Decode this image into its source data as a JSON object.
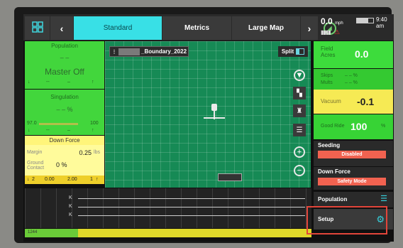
{
  "topbar": {
    "tabs": [
      "Standard",
      "Metrics",
      "Large Map"
    ],
    "active_tab": "Standard",
    "speed_value": "0.0",
    "speed_unit": "mph",
    "clock": "9:40 am",
    "colors": {
      "active_tab": "#38e0e6"
    }
  },
  "left": {
    "population": {
      "title": "Population",
      "value": "– –",
      "status": "Master Off",
      "row_dashes": "–",
      "row_sep": "--"
    },
    "singulation": {
      "title": "Singulation",
      "value": "– – %",
      "min": "97.0",
      "max": "100"
    },
    "down_force": {
      "title": "Down Force",
      "margin_label": "Margin",
      "margin_value": "0.25",
      "margin_unit": "lbs",
      "ground_contact_label": "Ground Contact",
      "ground_contact_value": "0 %",
      "footer_left": "2",
      "footer_mid": "0.00",
      "footer_right": "2.00",
      "footer_right_num": "1"
    }
  },
  "map": {
    "field_name": "_Boundary_2022",
    "split_label": "Split",
    "colors": {
      "background": "#168a55"
    }
  },
  "graph": {
    "k_labels": [
      "K",
      "K",
      "K"
    ],
    "bottom_label": "1244"
  },
  "right": {
    "field_acres_label": "Field Acres",
    "field_acres_value": "0.0",
    "skips_label": "Skips",
    "skips_value": "– – %",
    "mults_label": "Mults",
    "mults_value": "– – %",
    "vacuum_label": "Vacuum",
    "vacuum_value": "-0.1",
    "good_ride_label": "Good Ride",
    "good_ride_value": "100",
    "good_ride_unit": "%",
    "seeding_label": "Seeding",
    "seeding_status": "Disabled",
    "down_force_label": "Down Force",
    "down_force_status": "Safety Mode",
    "population_label": "Population",
    "setup_label": "Setup",
    "colors": {
      "status_red": "#f16250",
      "highlight_box": "#e2453a"
    }
  }
}
